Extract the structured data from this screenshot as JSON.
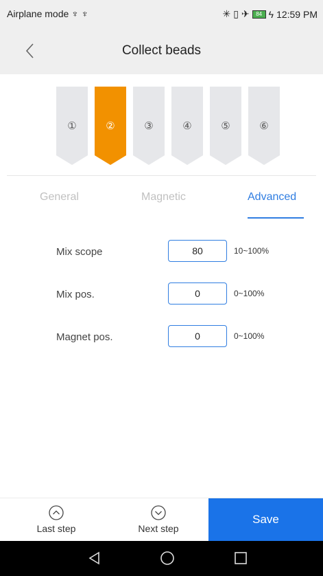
{
  "status": {
    "left_text": "Airplane mode ♆ ♆",
    "battery": "84",
    "time": "12:59 PM"
  },
  "header": {
    "title": "Collect beads"
  },
  "steps": [
    "①",
    "②",
    "③",
    "④",
    "⑤",
    "⑥"
  ],
  "active_step_index": 1,
  "tabs": [
    "General",
    "Magnetic",
    "Advanced"
  ],
  "active_tab": "Advanced",
  "fields": [
    {
      "label": "Mix scope",
      "value": "80",
      "range": "10~100%"
    },
    {
      "label": "Mix pos.",
      "value": "0",
      "range": "0~100%"
    },
    {
      "label": "Magnet pos.",
      "value": "0",
      "range": "0~100%"
    }
  ],
  "bottom": {
    "last_step": "Last step",
    "next_step": "Next step",
    "save": "Save"
  },
  "colors": {
    "accent": "#1a73e8",
    "active_step": "#f29100",
    "inactive_step": "#e6e7ea"
  }
}
